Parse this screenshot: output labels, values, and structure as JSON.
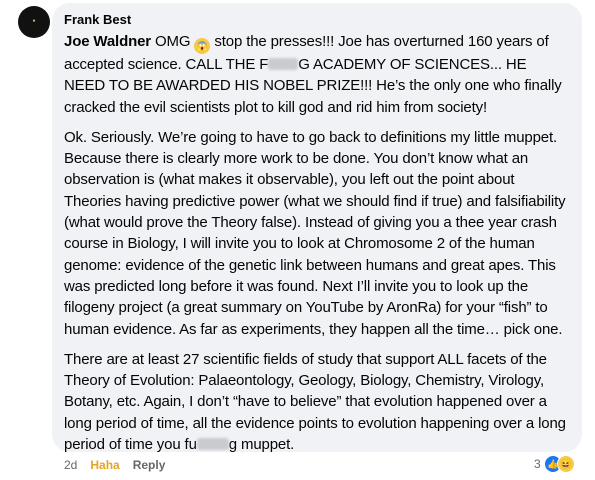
{
  "comment": {
    "author": "Frank Best",
    "paragraphs": [
      {
        "mention": "Joe Waldner",
        "text_a": " OMG ",
        "text_b": " stop the presses!!! Joe has overturned 160 years of accepted science. CALL THE F",
        "text_c": "G ACADEMY OF SCIENCES... HE NEED TO BE AWARDED HIS NOBEL PRIZE!!! He’s the only one who finally cracked the evil scientists plot to kill god and rid him from society!"
      },
      {
        "text": "Ok. Seriously. We’re going to have to go back to definitions my little muppet. Because there is clearly more work to be done. You don’t know what an observation is (what makes it observable), you left out the point about Theories having predictive power (what we should find if true) and falsifiability (what would prove the Theory false). Instead of giving you a thee year crash course in Biology, I will invite you to look at Chromosome 2 of the human genome: evidence of the genetic link between humans and great apes. This was predicted long before it was found. Next I’ll invite you to look up the filogeny project (a great summary on YouTube by AronRa) for your “fish” to human evidence. As far as experiments, they happen all the time… pick one."
      },
      {
        "text_a": "There are at least 27 scientific fields of study that support ALL facets of the Theory of Evolution: Palaeontology, Geology, Biology, Chemistry, Virology, Botany, etc. Again, I don’t “have to believe” that evolution happened over a long period of time, all the evidence points to evolution happening over a long period of time you fu",
        "text_b": "g muppet."
      }
    ]
  },
  "actions": {
    "time": "2d",
    "reaction_label": "Haha",
    "reply": "Reply"
  },
  "reactions": {
    "count": "3",
    "icons": [
      "like-icon",
      "haha-icon"
    ]
  },
  "colors": {
    "bubble": "#f0f2f5",
    "haha": "#e8a320",
    "muted": "#65676b",
    "like": "#1877f2"
  }
}
